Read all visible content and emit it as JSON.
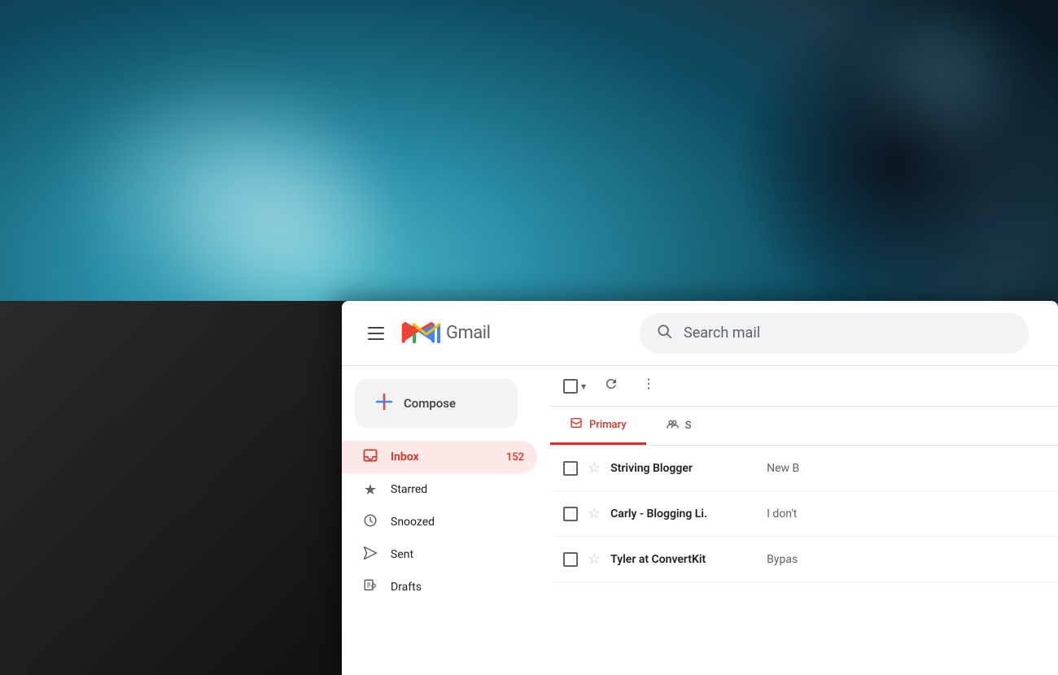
{
  "background": {
    "description": "Blurred teal ocean background"
  },
  "header": {
    "menu_label": "Main menu",
    "logo_text": "Gmail",
    "search_placeholder": "Search mail"
  },
  "compose": {
    "label": "Compose",
    "plus_symbol": "+"
  },
  "sidebar": {
    "items": [
      {
        "id": "inbox",
        "label": "Inbox",
        "count": "152",
        "active": true,
        "icon": "inbox"
      },
      {
        "id": "starred",
        "label": "Starred",
        "count": "",
        "active": false,
        "icon": "star"
      },
      {
        "id": "snoozed",
        "label": "Snoozed",
        "count": "",
        "active": false,
        "icon": "clock"
      },
      {
        "id": "sent",
        "label": "Sent",
        "count": "",
        "active": false,
        "icon": "send"
      },
      {
        "id": "drafts",
        "label": "Drafts",
        "count": "",
        "active": false,
        "icon": "draft"
      }
    ]
  },
  "toolbar": {
    "select_label": "Select",
    "refresh_label": "Refresh",
    "more_label": "More"
  },
  "tabs": [
    {
      "id": "primary",
      "label": "Primary",
      "active": true
    },
    {
      "id": "social",
      "label": "S",
      "active": false
    }
  ],
  "emails": [
    {
      "sender": "Striving Blogger",
      "preview": "New B",
      "read": false
    },
    {
      "sender": "Carly - Blogging Li.",
      "preview": "I don't",
      "read": false
    },
    {
      "sender": "Tyler at ConvertKit",
      "preview": "Bypas",
      "read": false
    }
  ],
  "colors": {
    "gmail_red": "#d93025",
    "gmail_blue": "#4285f4",
    "gmail_yellow": "#fbbc04",
    "gmail_green": "#34a853",
    "text_dark": "#202124",
    "text_medium": "#5f6368",
    "bg_light": "#f1f3f4",
    "accent_red": "#ea4335"
  }
}
